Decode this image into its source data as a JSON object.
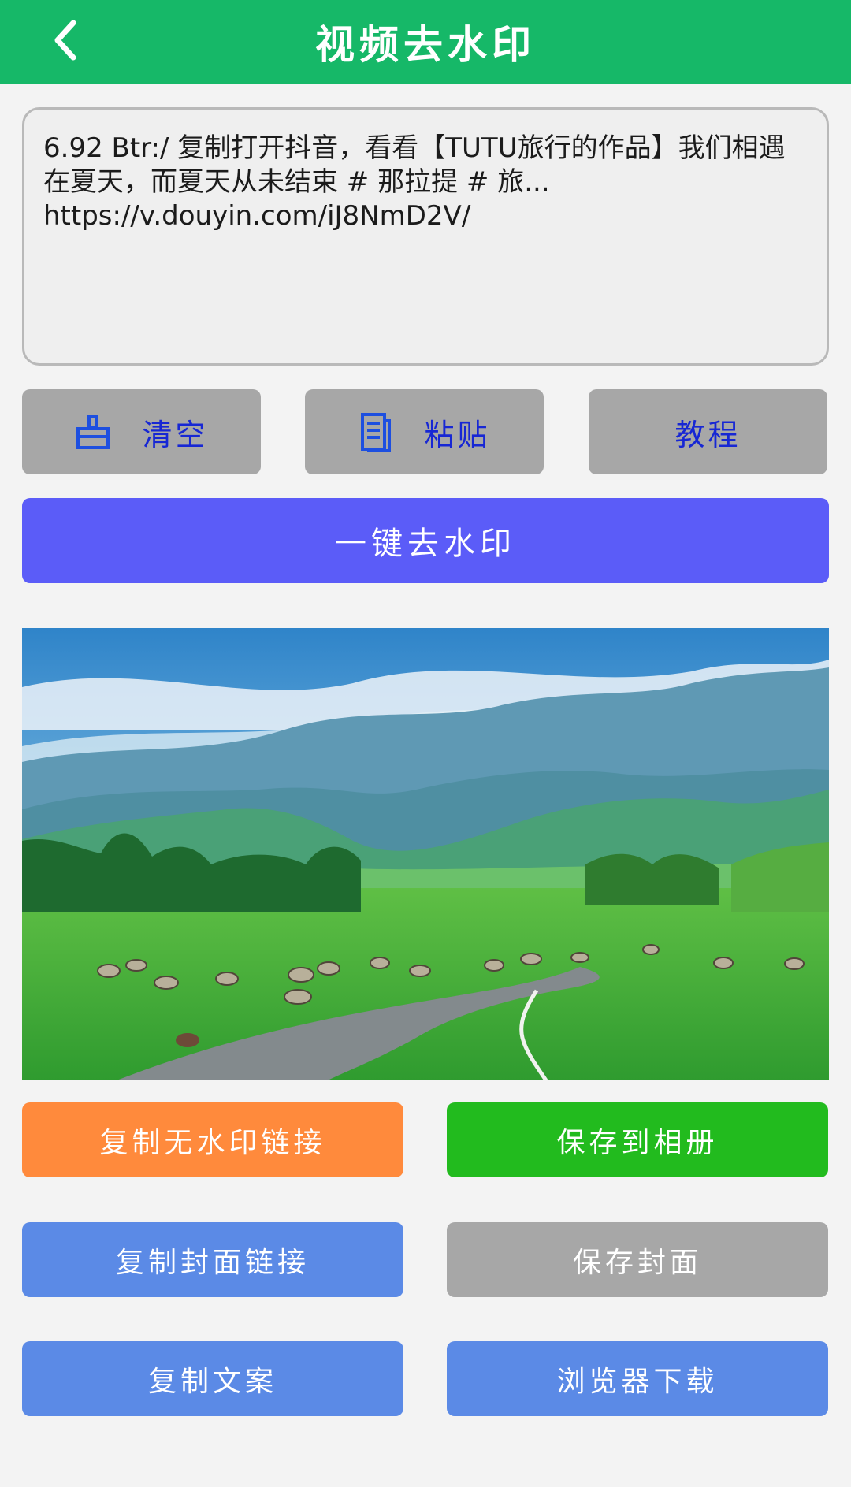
{
  "header": {
    "title": "视频去水印",
    "back_icon": "chevron-left-icon"
  },
  "share_input": {
    "text": "6.92 Btr:/ 复制打开抖音，看看【TUTU旅行的作品】我们相遇在夏天，而夏天从未结束 # 那拉提 # 旅...",
    "url": "https://v.douyin.com/iJ8NmD2V/"
  },
  "toolbar": {
    "clear_label": "清空",
    "clear_icon": "broom-icon",
    "paste_label": "粘贴",
    "paste_icon": "document-icon",
    "tutorial_label": "教程"
  },
  "main_action": {
    "label": "一键去水印"
  },
  "preview": {
    "image": "landscape-thumbnail"
  },
  "actions": {
    "copy_clean_link": "复制无水印链接",
    "save_to_album": "保存到相册",
    "copy_cover_link": "复制封面链接",
    "save_cover": "保存封面",
    "copy_caption": "复制文案",
    "browser_download": "浏览器下载"
  },
  "colors": {
    "header": "#16b868",
    "main_button": "#5b5cf8",
    "orange_button": "#ff8a3c",
    "green_button": "#22bb1e",
    "blue_button": "#5b8ae6",
    "gray_button": "#a7a7a7"
  }
}
